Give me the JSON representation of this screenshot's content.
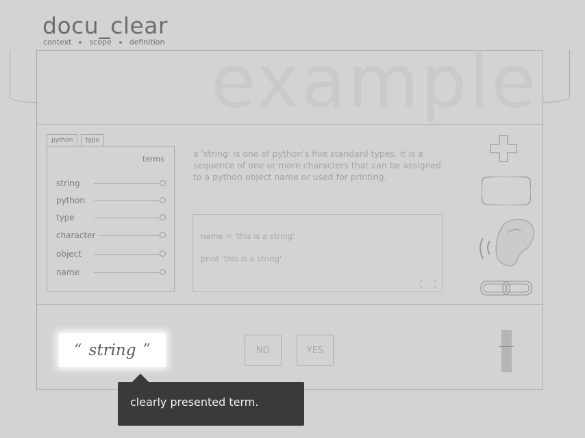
{
  "app": {
    "logo": "docu_clear",
    "nav": [
      "context",
      "scope",
      "definition"
    ]
  },
  "hero": {
    "watermark": "example"
  },
  "terms_panel": {
    "tabs": [
      "python",
      "type"
    ],
    "title": "terms",
    "items": [
      "string",
      "python",
      "type",
      "character",
      "object",
      "name"
    ]
  },
  "definition": {
    "text": "a 'string' is one of python's five standard types.  it is a sequence of one or more characters that can be assigned to a python object name or used for printing.",
    "code": [
      "name = 'this is a string'",
      "print 'this is a string'"
    ]
  },
  "tools": {
    "icons": [
      "plus-icon",
      "screen-icon",
      "ear-icon",
      "link-icon"
    ]
  },
  "footer": {
    "current_term": "string",
    "open_quote": "“",
    "close_quote": "”",
    "no_label": "NO",
    "yes_label": "YES"
  },
  "tooltip": {
    "text": "clearly presented term."
  },
  "colors": {
    "background": "#d3d3d3",
    "border": "#a9a9a9",
    "tooltip_bg": "#3a3a3a",
    "term_bg": "#ffffff"
  }
}
